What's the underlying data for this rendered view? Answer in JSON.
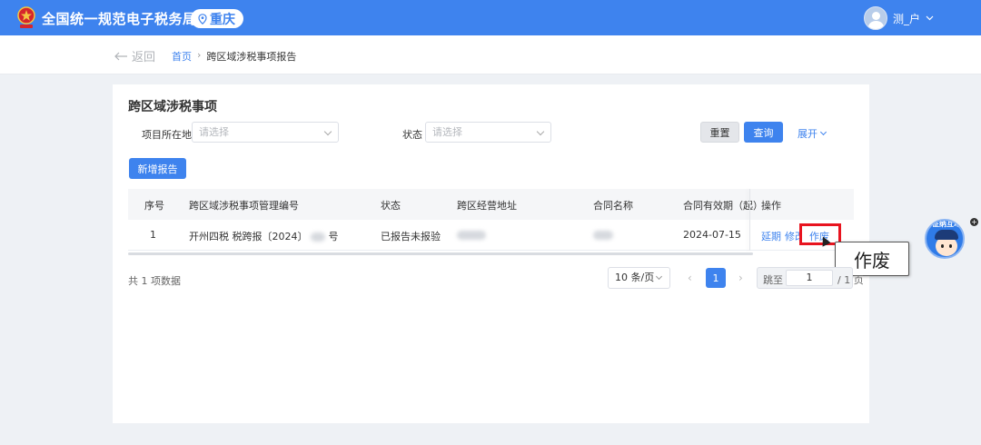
{
  "header": {
    "site_title": "全国统一规范电子税务局",
    "region": "重庆",
    "user_name": "测_户"
  },
  "breadcrumb": {
    "back_label": "返回",
    "home": "首页",
    "separator": "›",
    "current": "跨区域涉税事项报告"
  },
  "panel": {
    "title": "跨区域涉税事项",
    "filters": {
      "location_label": "项目所在地",
      "location_placeholder": "请选择",
      "status_label": "状态",
      "status_placeholder": "请选择"
    },
    "reset_label": "重置",
    "query_label": "查询",
    "expand_label": "展开",
    "new_report_label": "新增报告"
  },
  "table": {
    "columns": [
      "序号",
      "跨区域涉税事项管理编号",
      "状态",
      "跨区经营地址",
      "合同名称",
      "合同有效期（起）",
      "操作"
    ],
    "rows": [
      {
        "index": "1",
        "code_prefix": "开州四税 税跨报〔2024〕",
        "code_suffix": "号",
        "status": "已报告未报验",
        "valid_from": "2024-07-15",
        "actions": [
          "延期",
          "修改",
          "作废"
        ]
      }
    ]
  },
  "tooltip": {
    "text": "作废"
  },
  "pagination": {
    "total": "共 1 项数据",
    "page_size": "10 条/页",
    "prev": "‹",
    "next": "›",
    "current_page": "1",
    "jump_label": "跳至",
    "jump_value": "1",
    "page_count": "/ 1 页"
  },
  "assistant": {
    "label": "征纳互动"
  },
  "colors": {
    "primary": "#3e83ee",
    "highlight": "#e8141f"
  }
}
